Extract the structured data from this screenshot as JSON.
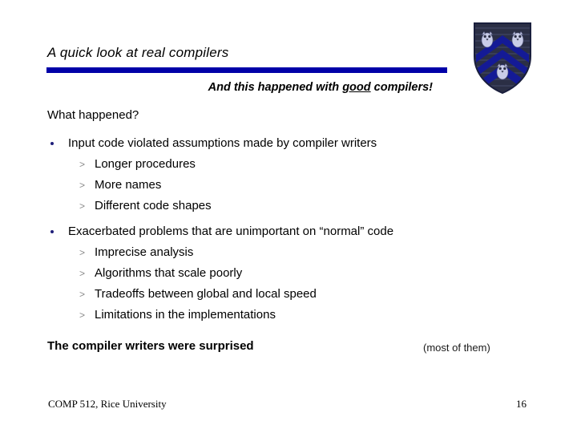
{
  "slide": {
    "title": "A quick look at real compilers",
    "subtitle_pre": "And this happened with ",
    "subtitle_emphasis": "good",
    "subtitle_post": " compilers!",
    "lead_in": "What happened?",
    "bullet_blocks": [
      {
        "bullet": "Input code violated assumptions made by compiler writers",
        "sub_marker": ">",
        "subs": [
          "Longer procedures",
          "More names",
          "Different code shapes"
        ]
      },
      {
        "bullet": "Exacerbated problems that are unimportant on “normal” code",
        "sub_marker": ">",
        "subs": [
          "Imprecise analysis",
          "Algorithms that scale poorly",
          "Tradeoffs between global and local speed",
          "Limitations in the implementations"
        ]
      }
    ],
    "closing_line": "The compiler writers were surprised",
    "closing_aside": "(most of them)"
  },
  "footer": {
    "course": "COMP 512, Rice University",
    "page_number": "16"
  },
  "logo": {
    "name": "rice-university-shield-logo",
    "shield_dark": "#2b2f45",
    "shield_navy": "#1a1f7a",
    "chevron_blue": "#141a96",
    "owl_color": "#c9cde8"
  },
  "colors": {
    "rule_blue": "#0000A8",
    "bullet_navy": "#1F1F7A",
    "sub_marker_gray": "#8a8a8a",
    "background": "#ffffff",
    "text": "#000000"
  }
}
